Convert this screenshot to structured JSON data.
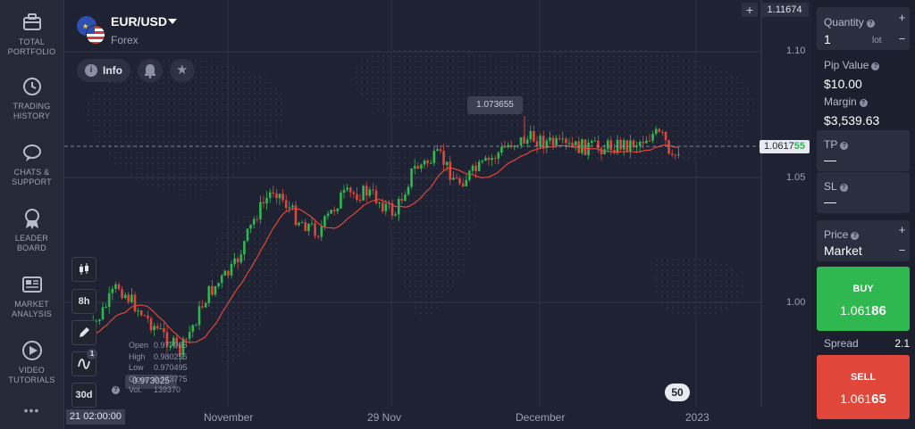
{
  "sidebar": {
    "items": [
      {
        "label": "TOTAL\nPORTFOLIO",
        "icon": "briefcase-icon"
      },
      {
        "label": "TRADING\nHISTORY",
        "icon": "history-icon"
      },
      {
        "label": "CHATS &\nSUPPORT",
        "icon": "chat-icon"
      },
      {
        "label": "LEADER\nBOARD",
        "icon": "medal-icon"
      },
      {
        "label": "MARKET\nANALYSIS",
        "icon": "newspaper-icon"
      },
      {
        "label": "VIDEO\nTUTORIALS",
        "icon": "play-icon"
      }
    ],
    "more": "•••"
  },
  "asset": {
    "name": "EUR/USD",
    "category": "Forex",
    "info_label": "Info"
  },
  "chart": {
    "plus": "+",
    "top_price": "1.11674",
    "price_levels": [
      "1.10",
      "1.05",
      "1.00"
    ],
    "current_price_main": "1.0617",
    "current_price_tail": "55",
    "high_marker": "1.073655",
    "low_marker": "0.973025",
    "time_labels": [
      "November",
      "29 Nov",
      "December",
      "2023"
    ],
    "cursor_time": "21 02:00:00",
    "zoom": "50",
    "timeframe": "8h",
    "period": "30d",
    "indicator_count": "1",
    "ohlc": {
      "open_label": "Open",
      "open": "0.977905",
      "high_label": "High",
      "high": "0.980255",
      "low_label": "Low",
      "low": "0.970495",
      "close_label": "Close",
      "close": "0.973775",
      "vol_label": "Vol.",
      "vol": "139370"
    },
    "colors": {
      "up": "#2fb850",
      "down": "#e0463a",
      "ma": "#e0463a"
    }
  },
  "panel": {
    "quantity_label": "Quantity",
    "quantity": "1",
    "quantity_unit": "lot",
    "pip_label": "Pip Value",
    "pip_value": "$10.00",
    "margin_label": "Margin",
    "margin_value": "$3,539.63",
    "tp_label": "TP",
    "tp_value": "—",
    "sl_label": "SL",
    "sl_value": "—",
    "price_label": "Price",
    "price_value": "Market",
    "buy_label": "BUY",
    "buy_main": "1.061",
    "buy_big": "86",
    "sell_label": "SELL",
    "sell_main": "1.061",
    "sell_big": "65",
    "spread_label": "Spread",
    "spread_value": "2.1",
    "plus": "+",
    "minus": "−",
    "buy_color": "#2fb850",
    "sell_color": "#e0463a"
  }
}
